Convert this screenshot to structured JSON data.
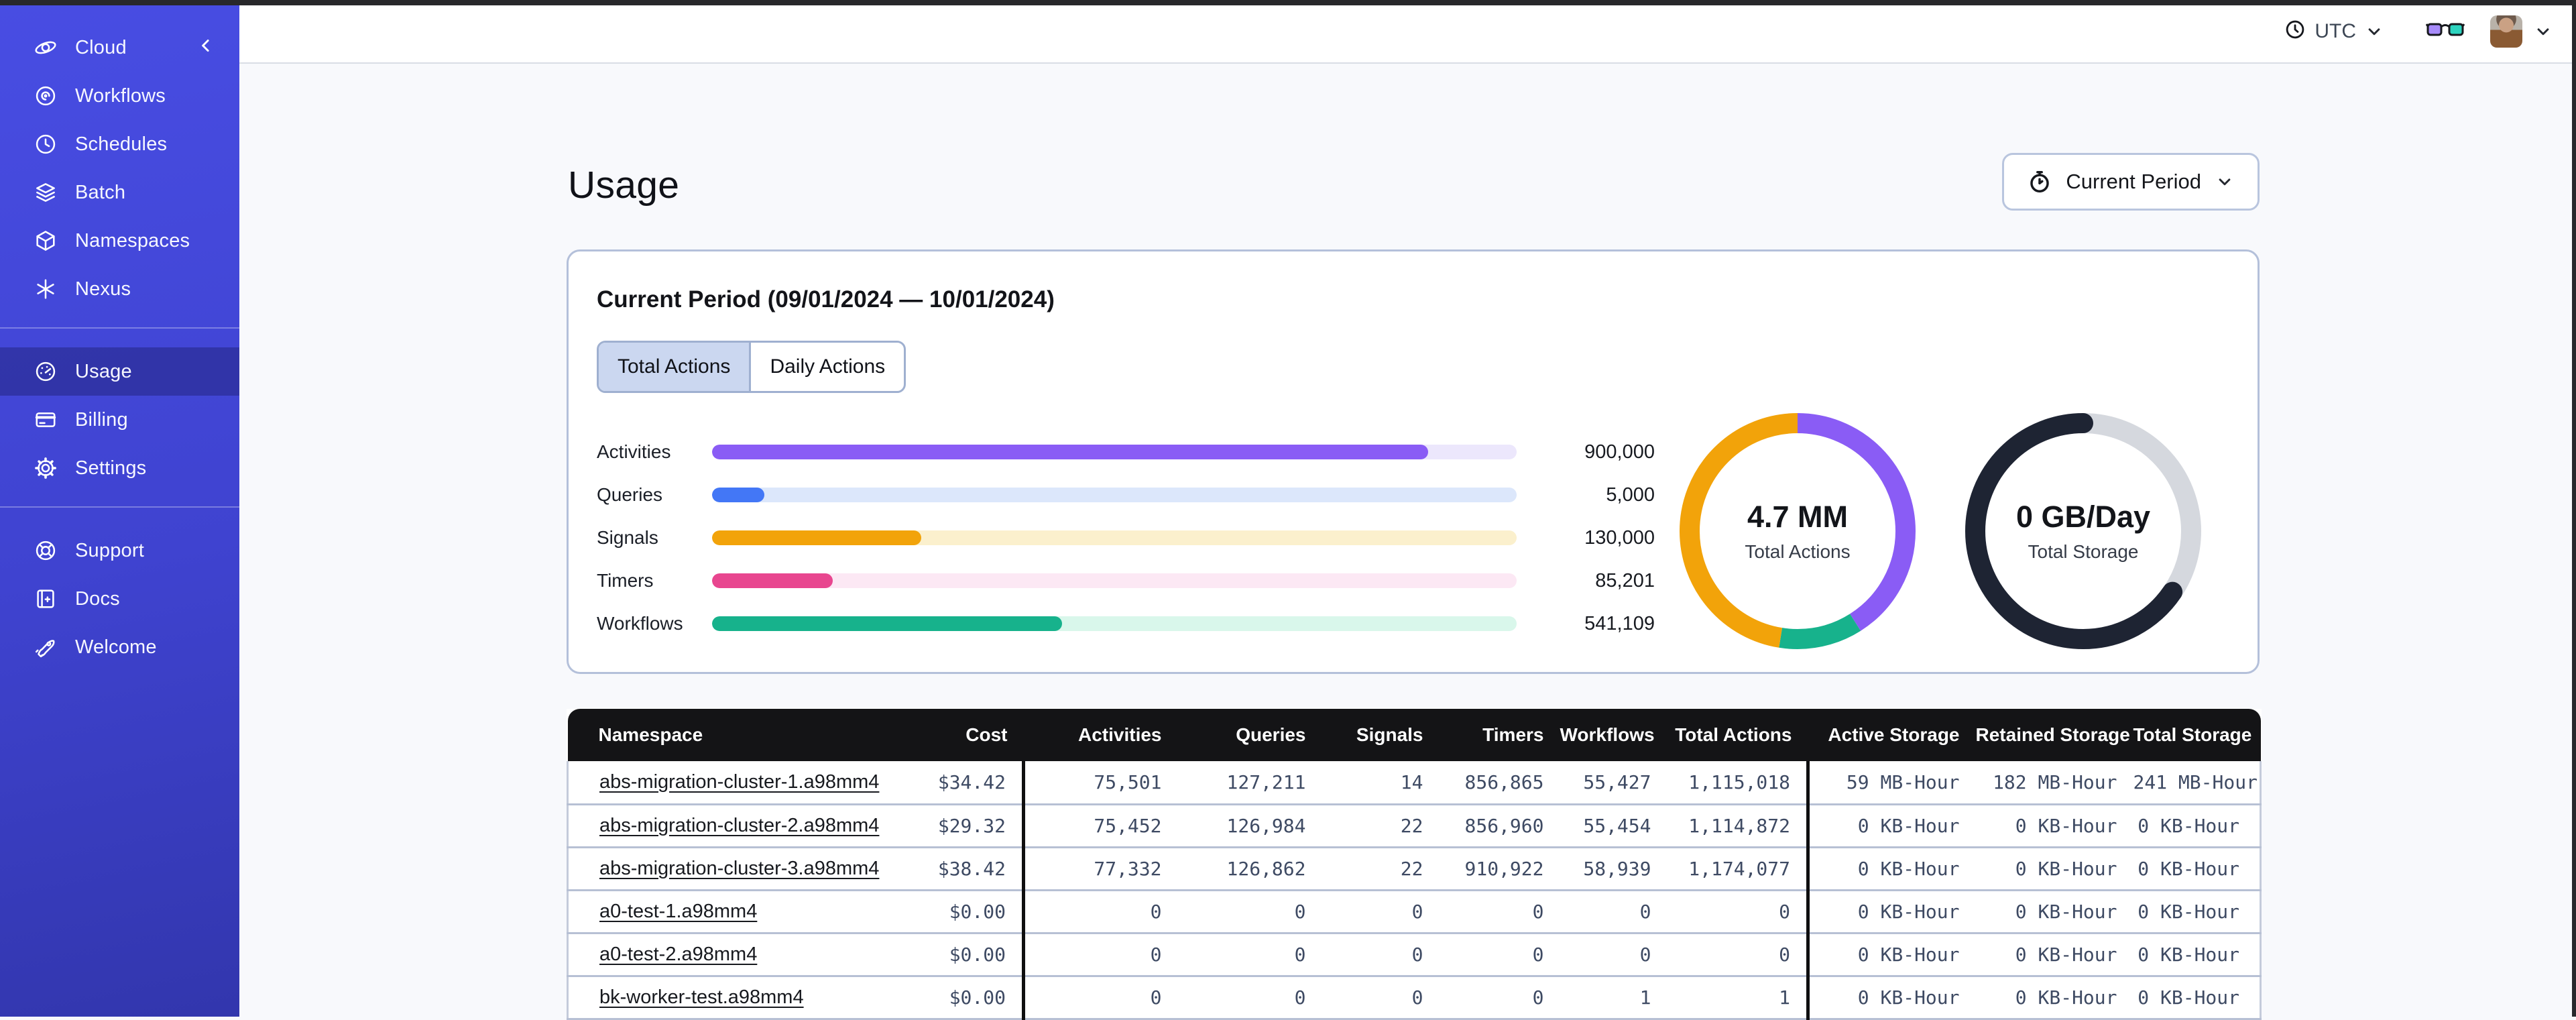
{
  "chrome": {
    "timezone": "UTC"
  },
  "sidebar": {
    "groups": [
      {
        "items": [
          {
            "label": "Cloud"
          },
          {
            "label": "Workflows"
          },
          {
            "label": "Schedules"
          },
          {
            "label": "Batch"
          },
          {
            "label": "Namespaces"
          },
          {
            "label": "Nexus"
          }
        ]
      },
      {
        "items": [
          {
            "label": "Usage",
            "active": true
          },
          {
            "label": "Billing"
          },
          {
            "label": "Settings"
          }
        ]
      },
      {
        "items": [
          {
            "label": "Support"
          },
          {
            "label": "Docs"
          },
          {
            "label": "Welcome"
          }
        ]
      }
    ]
  },
  "page": {
    "title": "Usage",
    "period_button_label": "Current Period"
  },
  "usage_panel": {
    "title": "Current Period (09/01/2024 — 10/01/2024)",
    "tabs": [
      {
        "label": "Total Actions",
        "active": true
      },
      {
        "label": "Daily Actions",
        "active": false
      }
    ],
    "chart_data": {
      "type": "bar",
      "categories": [
        "Activities",
        "Queries",
        "Signals",
        "Timers",
        "Workflows"
      ],
      "values": [
        "900,000",
        "5,000",
        "130,000",
        "85,201",
        "541,109"
      ]
    },
    "bars": [
      {
        "label": "Activities",
        "value": "900,000",
        "percent": 89,
        "color": "#8a5cf5",
        "track": "#ece7fc"
      },
      {
        "label": "Queries",
        "value": "5,000",
        "percent": 6.5,
        "color": "#4377f6",
        "track": "#dce7fb"
      },
      {
        "label": "Signals",
        "value": "130,000",
        "percent": 26,
        "color": "#f2a30a",
        "track": "#fbf0cd"
      },
      {
        "label": "Timers",
        "value": "85,201",
        "percent": 15,
        "color": "#e8468f",
        "track": "#fce8f4"
      },
      {
        "label": "Workflows",
        "value": "541,109",
        "percent": 43.5,
        "color": "#17b28c",
        "track": "#d9f7eb"
      }
    ],
    "donuts": [
      {
        "value": "4.7 MM",
        "label": "Total Actions",
        "segments": [
          {
            "name": "activities",
            "color": "#8a5cf5",
            "fraction": 0.41,
            "cap": "butt"
          },
          {
            "name": "workflows",
            "color": "#17b28c",
            "fraction": 0.115,
            "cap": "butt"
          },
          {
            "name": "signals",
            "color": "#f2a30a",
            "fraction": 0.475,
            "cap": "butt"
          }
        ]
      },
      {
        "value": "0 GB/Day",
        "label": "Total Storage",
        "segments": [
          {
            "name": "remaining",
            "color": "#d5d8de",
            "fraction": 0.345,
            "cap": "butt"
          },
          {
            "name": "used",
            "color": "#1e2433",
            "fraction": 0.655,
            "cap": "round"
          }
        ]
      }
    ]
  },
  "table": {
    "columns": [
      "Namespace",
      "Cost",
      "Activities",
      "Queries",
      "Signals",
      "Timers",
      "Workflows",
      "Total Actions",
      "Active Storage",
      "Retained Storage",
      "Total Storage"
    ],
    "rows": [
      [
        "abs-migration-cluster-1.a98mm4",
        "$34.42",
        "75,501",
        "127,211",
        "14",
        "856,865",
        "55,427",
        "1,115,018",
        "59 MB-Hour",
        "182 MB-Hour",
        "241 MB-Hour"
      ],
      [
        "abs-migration-cluster-2.a98mm4",
        "$29.32",
        "75,452",
        "126,984",
        "22",
        "856,960",
        "55,454",
        "1,114,872",
        "0 KB-Hour",
        "0 KB-Hour",
        "0 KB-Hour"
      ],
      [
        "abs-migration-cluster-3.a98mm4",
        "$38.42",
        "77,332",
        "126,862",
        "22",
        "910,922",
        "58,939",
        "1,174,077",
        "0 KB-Hour",
        "0 KB-Hour",
        "0 KB-Hour"
      ],
      [
        "a0-test-1.a98mm4",
        "$0.00",
        "0",
        "0",
        "0",
        "0",
        "0",
        "0",
        "0 KB-Hour",
        "0 KB-Hour",
        "0 KB-Hour"
      ],
      [
        "a0-test-2.a98mm4",
        "$0.00",
        "0",
        "0",
        "0",
        "0",
        "0",
        "0",
        "0 KB-Hour",
        "0 KB-Hour",
        "0 KB-Hour"
      ],
      [
        "bk-worker-test.a98mm4",
        "$0.00",
        "0",
        "0",
        "0",
        "0",
        "1",
        "1",
        "0 KB-Hour",
        "0 KB-Hour",
        "0 KB-Hour"
      ]
    ]
  }
}
